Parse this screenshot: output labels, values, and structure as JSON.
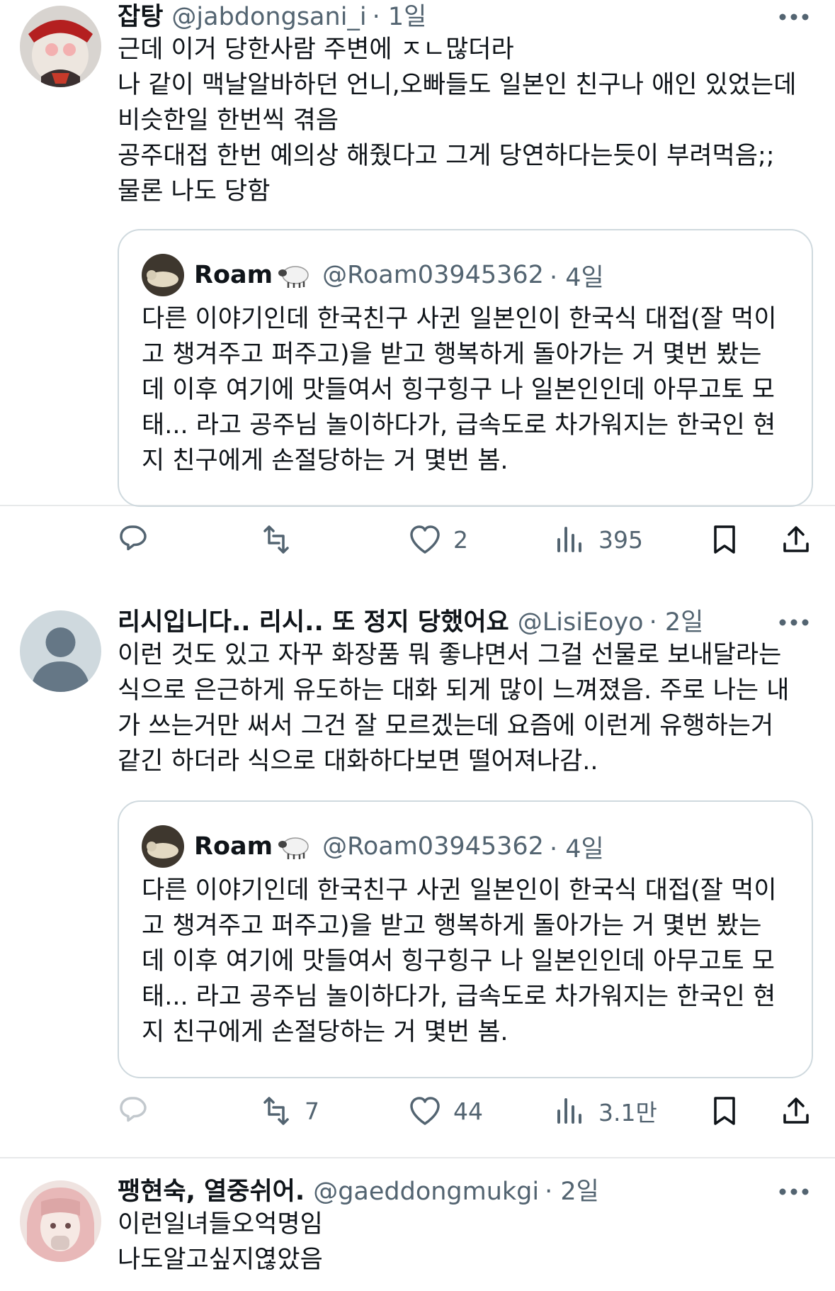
{
  "tweets": [
    {
      "display_name": "잡탕",
      "handle": "@jabdongsani_i",
      "time": "· 1일",
      "body": "근데 이거 당한사람 주변에 ㅈㄴ많더라\n나 같이 맥날알바하던 언니,오빠들도 일본인 친구나 애인 있었는데\n비슷한일 한번씩 겪음\n공주대접 한번 예의상 해줬다고 그게 당연하다는듯이 부려먹음;;\n물론 나도 당함",
      "quote": {
        "display_name": "Roam",
        "handle": "@Roam03945362",
        "time": "· 4일",
        "body": "다른 이야기인데 한국친구 사귄 일본인이 한국식 대접(잘 먹이\n고 챙겨주고 퍼주고)을 받고 행복하게 돌아가는 거 몇번 봤는\n데 이후 여기에 맛들여서 힝구힝구 나 일본인인데 아무고토 모\n태... 라고 공주님 놀이하다가, 급속도로 차가워지는 한국인 현\n지 친구에게 손절당하는 거 몇번 봄."
      },
      "replies": "",
      "retweets": "",
      "likes": "2",
      "views": "395"
    },
    {
      "display_name": "리시입니다.. 리시.. 또 정지 당했어요",
      "handle": "@LisiEoyo",
      "time": "· 2일",
      "body": "이런 것도 있고 자꾸 화장품 뭐 좋냐면서 그걸 선물로 보내달라는\n식으로 은근하게 유도하는 대화 되게 많이 느껴졌음. 주로 나는 내\n가 쓰는거만 써서 그건 잘 모르겠는데 요즘에 이런게 유행하는거\n같긴 하더라 식으로 대화하다보면 떨어져나감..",
      "quote": {
        "display_name": "Roam",
        "handle": "@Roam03945362",
        "time": "· 4일",
        "body": "다른 이야기인데 한국친구 사귄 일본인이 한국식 대접(잘 먹이\n고 챙겨주고 퍼주고)을 받고 행복하게 돌아가는 거 몇번 봤는\n데 이후 여기에 맛들여서 힝구힝구 나 일본인인데 아무고토 모\n태... 라고 공주님 놀이하다가, 급속도로 차가워지는 한국인 현\n지 친구에게 손절당하는 거 몇번 봄."
      },
      "replies": "",
      "retweets": "7",
      "likes": "44",
      "views": "3.1만"
    },
    {
      "display_name": "팽현숙, 열중쉬어.",
      "handle": "@gaeddongmukgi",
      "time": "· 2일",
      "body": "이런일녀들오억명임\n나도알고싶지엲았음"
    }
  ],
  "icons": {
    "more": "more-horizontal-icon",
    "reply": "reply-bubble-icon",
    "retweet": "retweet-icon",
    "like": "heart-icon",
    "views": "views-bar-chart-icon",
    "bookmark": "bookmark-icon",
    "share": "share-upload-icon",
    "quote_badge": "sheep-emoji-icon"
  },
  "colors": {
    "text": "#0f1419",
    "muted": "#536471",
    "border": "#cfd9de",
    "divider": "#e7e9ea"
  }
}
